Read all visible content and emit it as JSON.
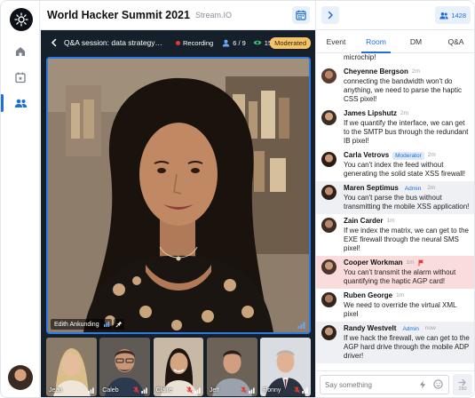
{
  "app": {
    "title": "World Hacker Summit 2021",
    "subtitle": "Stream.IO"
  },
  "stage": {
    "session_title": "Q&A session: data strategy…",
    "recording_label": "Recording",
    "participants_count": "6 / 9",
    "views_count": "150",
    "moderated_label": "Moderated",
    "main_speaker": "Edith Ankunding"
  },
  "participants": [
    {
      "name": "Jean"
    },
    {
      "name": "Caleb"
    },
    {
      "name": "Claire"
    },
    {
      "name": "Jeff"
    },
    {
      "name": "Ronny"
    }
  ],
  "panel": {
    "people_count": "1428",
    "tabs": [
      "Event",
      "Room",
      "DM",
      "Q&A"
    ],
    "active_tab": "Room"
  },
  "chat": {
    "clipped_text": "microchip!",
    "messages": [
      {
        "name": "Cheyenne Bergson",
        "role": "",
        "time": "2m",
        "text": "connecting the bandwidth won't do anything, we need to parse the haptic CSS pixel!"
      },
      {
        "name": "James Lipshutz",
        "role": "",
        "time": "2m",
        "text": "If we quantify the interface, we can get to the SMTP bus through the redundant IB pixel!"
      },
      {
        "name": "Carla Vetrovs",
        "role": "Moderator",
        "time": "2m",
        "text": "You can't index the feed without generating the solid state XSS firewall!"
      },
      {
        "name": "Maren Septimus",
        "role": "Admin",
        "time": "2m",
        "text": "You can't parse the bus without transmitting the mobile XSS application!"
      },
      {
        "name": "Zain Carder",
        "role": "",
        "time": "1m",
        "text": "If we index the matrix, we can get to the EXE firewall through the neural SMS pixel!"
      },
      {
        "name": "Cooper Workman",
        "role": "",
        "time": "1m",
        "text": "You can't transmit the alarm without quantifying the haptic AGP card!"
      },
      {
        "name": "Ruben George",
        "role": "",
        "time": "1m",
        "text": "We need to override the virtual XML pixel"
      },
      {
        "name": "Randy Westvelt",
        "role": "Admin",
        "time": "now",
        "text": "If we hack the firewall, we can get to the AGP hard drive through the mobile ADP driver!"
      }
    ]
  },
  "composer": {
    "placeholder": "Say something",
    "char_limit": "280"
  }
}
